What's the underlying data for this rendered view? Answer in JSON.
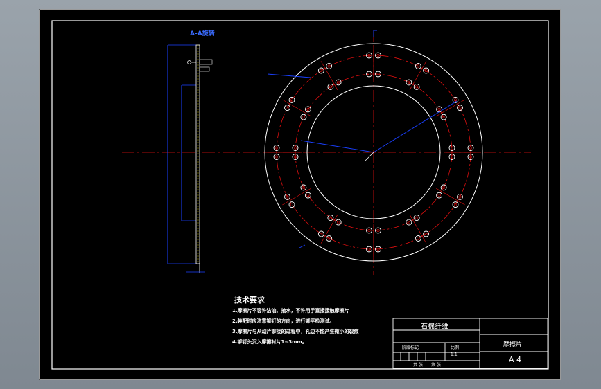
{
  "view_label": "A-A旋转",
  "tech_requirements": {
    "title": "技术要求",
    "items": [
      "1.摩擦片不容许沾油、抽水，不许用手直接接触摩擦片",
      "2.装配时应注意铆钉的方向，进行铆平检测试。",
      "3.摩擦片与从动片铆接的过程中，孔边不能产生微小的裂痕",
      "4.铆钉头沉入摩擦衬片1~3mm。"
    ]
  },
  "title_block": {
    "material": "石棉纤维",
    "part_name": "摩擦片",
    "sheet_size": "A 4",
    "label_weight": "阶段标记",
    "label_scale": "比例",
    "scale_value": "1:1",
    "footer_left": "共 张",
    "footer_right": "第 张"
  },
  "colors": {
    "background": "#000000",
    "outline": "#ffffff",
    "centerline": "#e01010",
    "dimension": "#1a40ff",
    "hatch": "#e0d000"
  }
}
